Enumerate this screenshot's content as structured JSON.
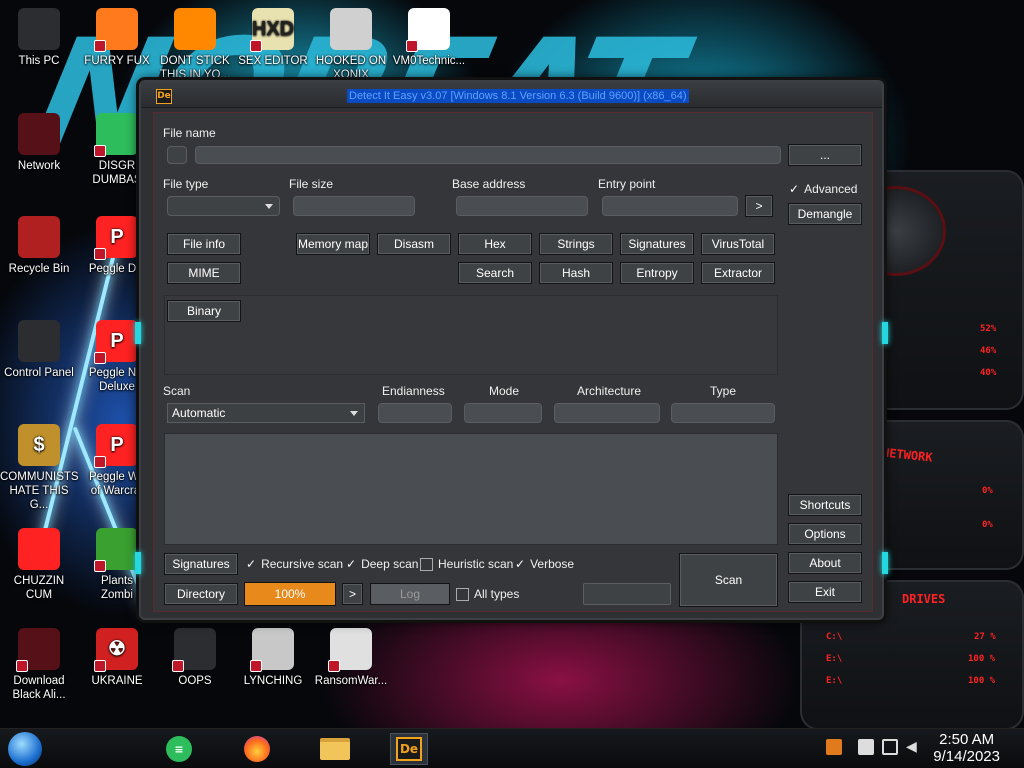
{
  "desktop": {
    "icons": [
      {
        "label": "This PC",
        "lines": [
          "This PC"
        ]
      },
      {
        "label": "FURRY FUX",
        "lines": [
          "FURRY FUX"
        ]
      },
      {
        "label": "DONT STICK THIS IN YO",
        "lines": [
          "DONT STICK",
          "THIS IN YO..."
        ]
      },
      {
        "label": "SEX EDITOR",
        "lines": [
          "SEX EDITOR"
        ]
      },
      {
        "label": "HOOKED ON XONIX",
        "lines": [
          "HOOKED ON",
          "XONIX"
        ]
      },
      {
        "label": "VM0Technic...",
        "lines": [
          "VM0Technic..."
        ]
      },
      {
        "label": "Network",
        "lines": [
          "Network"
        ]
      },
      {
        "label": "DISGRACE DUMBASS",
        "lines": [
          "DISGR",
          "DUMBAS"
        ]
      },
      {
        "label": "Recycle Bin",
        "lines": [
          "Recycle Bin"
        ]
      },
      {
        "label": "Peggle Deluxe",
        "lines": [
          "Peggle Del"
        ]
      },
      {
        "label": "Control Panel",
        "lines": [
          "Control Panel"
        ]
      },
      {
        "label": "Peggle Nights Deluxe",
        "lines": [
          "Peggle Nig",
          "Deluxe"
        ]
      },
      {
        "label": "COMMUNISTS HATE THIS G...",
        "lines": [
          "COMMUNISTS",
          "HATE THIS G..."
        ]
      },
      {
        "label": "Peggle World of Warcraft",
        "lines": [
          "Peggle Wo",
          "of Warcraf"
        ]
      },
      {
        "label": "CHUZZIN CUM",
        "lines": [
          "CHUZZIN",
          "CUM"
        ]
      },
      {
        "label": "Plants vs Zombies",
        "lines": [
          "Plants",
          "Zombi"
        ]
      },
      {
        "label": "Download Black Ali...",
        "lines": [
          "Download",
          "Black Ali..."
        ]
      },
      {
        "label": "UKRAINE",
        "lines": [
          "UKRAINE"
        ]
      },
      {
        "label": "OOPS",
        "lines": [
          "OOPS"
        ]
      },
      {
        "label": "LYNCHING",
        "lines": [
          "LYNCHING"
        ]
      },
      {
        "label": "RansomWar...",
        "lines": [
          "RansomWar..."
        ]
      }
    ],
    "widget": {
      "drives_label": "DRIVES",
      "network_label": "NETWORK",
      "bars": [
        "52%",
        "46%",
        "40%"
      ],
      "net": [
        "0%",
        "0%"
      ],
      "drive_rows": [
        {
          "name": "C:\\",
          "val": "27 %"
        },
        {
          "name": "E:\\",
          "val": "100 %"
        },
        {
          "name": "E:\\",
          "val": "100 %"
        }
      ]
    }
  },
  "window": {
    "title": "Detect It Easy v3.07 [Windows 8.1 Version 6.3 (Build 9600)] (x86_64)",
    "icon": "De",
    "labels": {
      "file_name": "File name",
      "file_type": "File type",
      "file_size": "File size",
      "base_address": "Base address",
      "entry_point": "Entry point",
      "scan": "Scan",
      "endianness": "Endianness",
      "mode": "Mode",
      "architecture": "Architecture",
      "type": "Type"
    },
    "buttons": {
      "browse": "...",
      "entry_go": ">",
      "demangle": "Demangle",
      "file_info": "File info",
      "memory_map": "Memory map",
      "disasm": "Disasm",
      "hex": "Hex",
      "strings": "Strings",
      "signatures_top": "Signatures",
      "virustotal": "VirusTotal",
      "mime": "MIME",
      "search": "Search",
      "hash": "Hash",
      "entropy": "Entropy",
      "extractor": "Extractor",
      "binary": "Binary",
      "shortcuts": "Shortcuts",
      "options": "Options",
      "about": "About",
      "exit": "Exit",
      "signatures_bottom": "Signatures",
      "directory": "Directory",
      "progress_next": ">",
      "log": "Log",
      "scan": "Scan"
    },
    "advanced": {
      "label": "Advanced",
      "checked": true
    },
    "scan_mode": "Automatic",
    "checks": {
      "recursive": {
        "label": "Recursive scan",
        "checked": true
      },
      "deep": {
        "label": "Deep scan",
        "checked": true
      },
      "heuristic": {
        "label": "Heuristic scan",
        "checked": false
      },
      "verbose": {
        "label": "Verbose",
        "checked": true
      },
      "all_types": {
        "label": "All types",
        "checked": false
      }
    },
    "progress": {
      "text": "100%",
      "value": 1.0
    }
  },
  "taskbar": {
    "apps": [
      "start-orb",
      "google-sheets-icon",
      "firefox-icon",
      "file-explorer-icon",
      "detect-it-easy-icon"
    ],
    "time": "2:50 AM",
    "date": "9/14/2023"
  },
  "colors": {
    "progress": "#e8891c",
    "accent_cyan": "#25d8e0",
    "widget_red": "#ff2222"
  }
}
